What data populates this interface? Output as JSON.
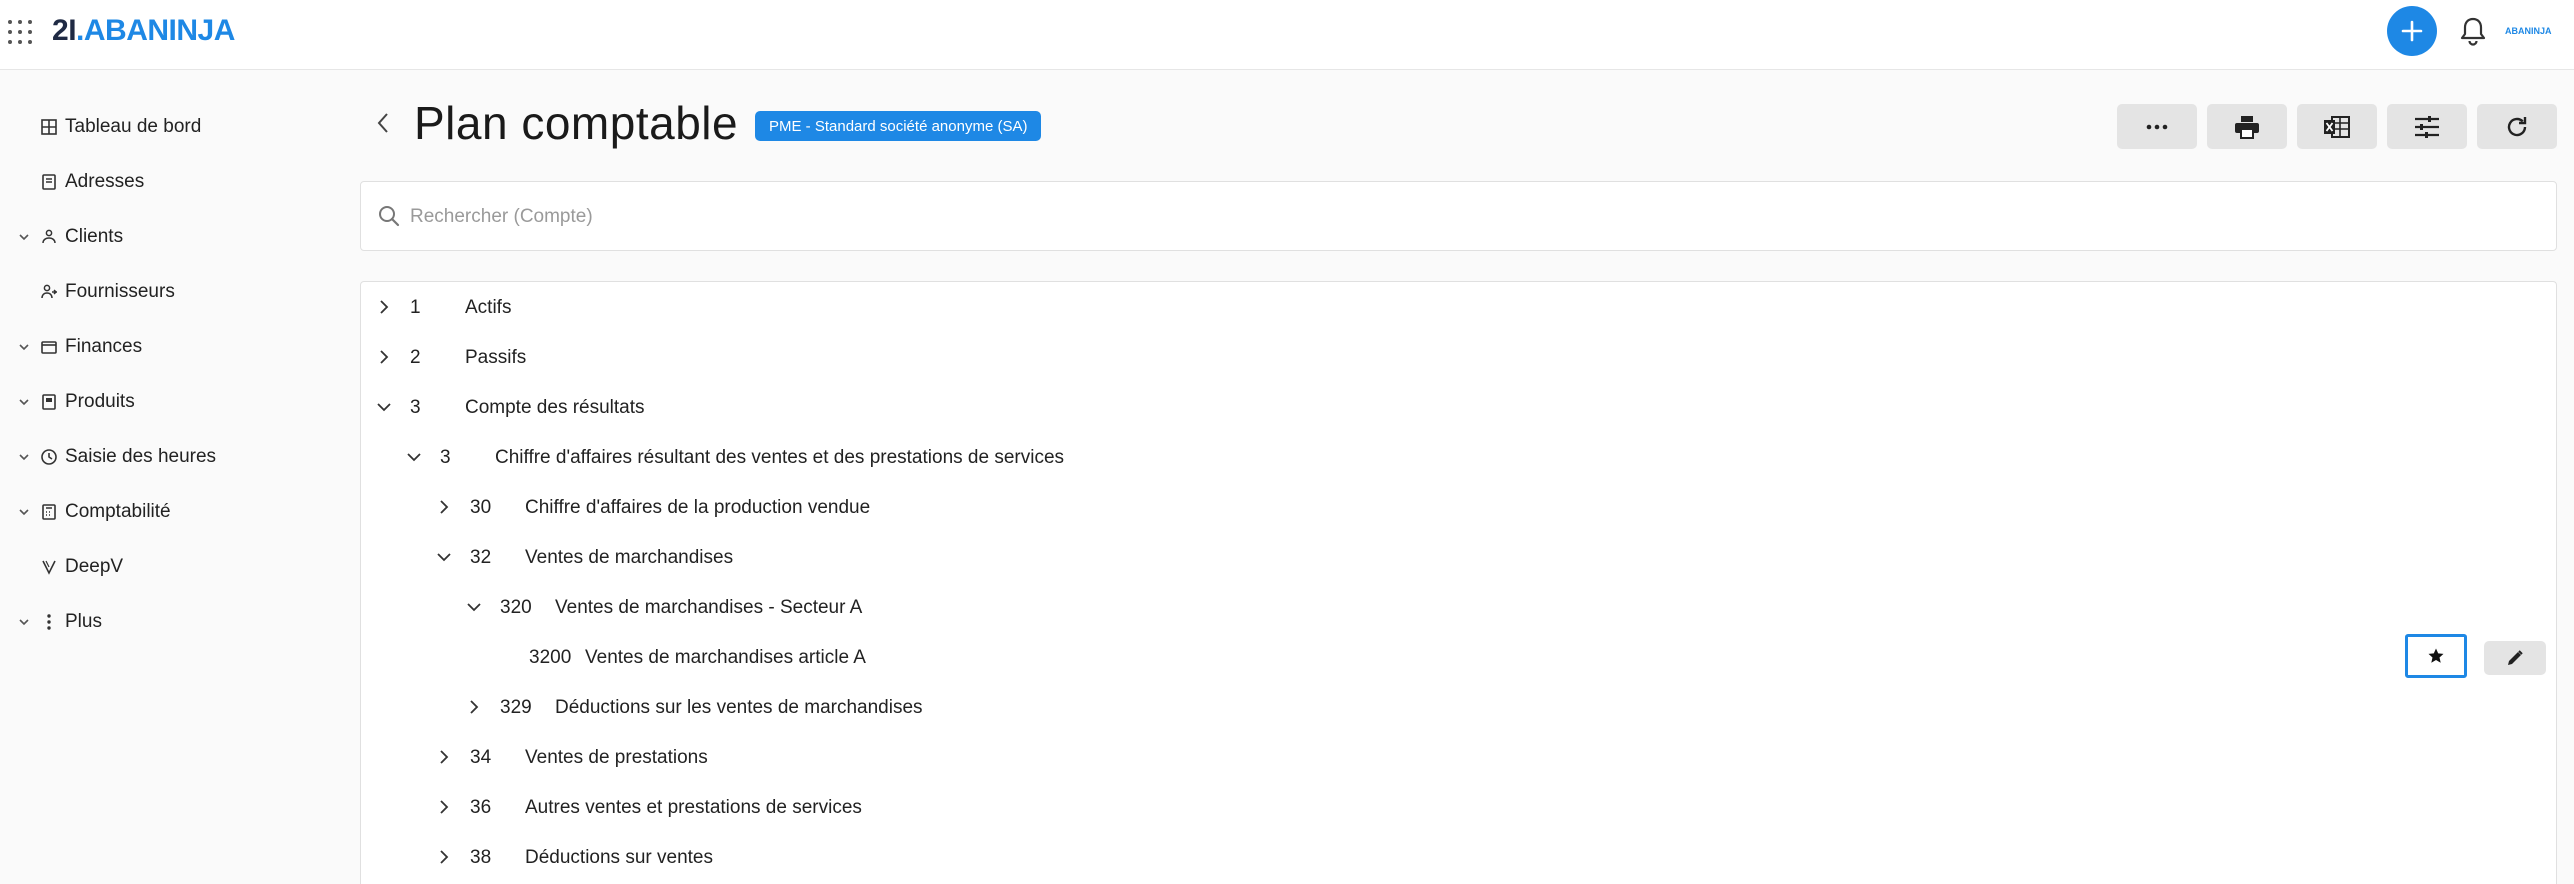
{
  "brand": {
    "num": "2",
    "mark": "I",
    "dot": ".",
    "name": "ABANINJA",
    "mini": "ABANINJA"
  },
  "colors": {
    "accent": "#1e88e5",
    "button_bg": "#e4e4e4",
    "text": "#222222"
  },
  "sidebar": {
    "items": [
      {
        "label": "Tableau de bord",
        "icon": "dashboard-icon",
        "expandable": false
      },
      {
        "label": "Adresses",
        "icon": "address-book-icon",
        "expandable": false
      },
      {
        "label": "Clients",
        "icon": "clients-icon",
        "expandable": true
      },
      {
        "label": "Fournisseurs",
        "icon": "suppliers-icon",
        "expandable": false
      },
      {
        "label": "Finances",
        "icon": "wallet-icon",
        "expandable": true
      },
      {
        "label": "Produits",
        "icon": "product-icon",
        "expandable": true
      },
      {
        "label": "Saisie des heures",
        "icon": "clock-icon",
        "expandable": true
      },
      {
        "label": "Comptabilité",
        "icon": "calculator-icon",
        "expandable": true
      },
      {
        "label": "DeepV",
        "icon": "deepv-icon",
        "expandable": false
      },
      {
        "label": "Plus",
        "icon": "more-vertical-icon",
        "expandable": true
      }
    ]
  },
  "header": {
    "title": "Plan comptable",
    "badge": "PME - Standard société anonyme (SA)",
    "toolbar": [
      "more-icon",
      "print-icon",
      "excel-icon",
      "filter-settings-icon",
      "refresh-icon"
    ]
  },
  "search": {
    "placeholder": "Rechercher (Compte)",
    "value": ""
  },
  "tree": {
    "rows": [
      {
        "level": 0,
        "toggle": "collapsed",
        "number": "1",
        "name": "Actifs"
      },
      {
        "level": 0,
        "toggle": "collapsed",
        "number": "2",
        "name": "Passifs"
      },
      {
        "level": 0,
        "toggle": "expanded",
        "number": "3",
        "name": "Compte des résultats"
      },
      {
        "level": 1,
        "toggle": "expanded",
        "number": "3",
        "name": "Chiffre d'affaires résultant des ventes et des prestations de services"
      },
      {
        "level": 2,
        "toggle": "collapsed",
        "number": "30",
        "name": "Chiffre d'affaires de la production vendue"
      },
      {
        "level": 2,
        "toggle": "expanded",
        "number": "32",
        "name": "Ventes de marchandises"
      },
      {
        "level": 3,
        "toggle": "expanded",
        "number": "320",
        "name": "Ventes de marchandises - Secteur A"
      },
      {
        "level": 4,
        "toggle": "none",
        "number": "3200",
        "name": "Ventes de marchandises article A"
      },
      {
        "level": 3,
        "toggle": "collapsed",
        "number": "329",
        "name": "Déductions sur les ventes de marchandises"
      },
      {
        "level": 2,
        "toggle": "collapsed",
        "number": "34",
        "name": "Ventes de prestations"
      },
      {
        "level": 2,
        "toggle": "collapsed",
        "number": "36",
        "name": "Autres ventes et prestations de services"
      },
      {
        "level": 2,
        "toggle": "collapsed",
        "number": "38",
        "name": "Déductions sur ventes"
      }
    ],
    "row_actions": [
      "star-icon",
      "edit-icon"
    ]
  }
}
